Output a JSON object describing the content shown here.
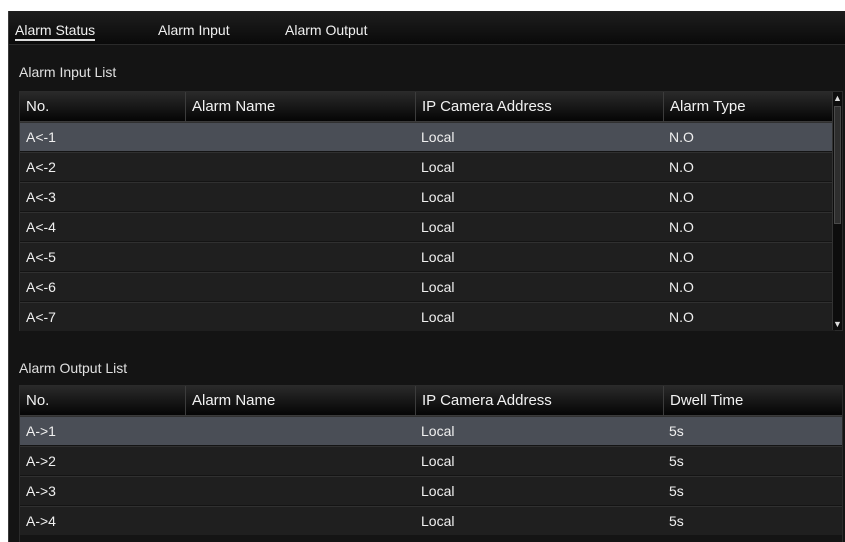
{
  "tabs": [
    {
      "label": "Alarm Status",
      "active": true
    },
    {
      "label": "Alarm Input",
      "active": false
    },
    {
      "label": "Alarm Output",
      "active": false
    }
  ],
  "input_list": {
    "title": "Alarm Input List",
    "columns": [
      "No.",
      "Alarm Name",
      "IP Camera Address",
      "Alarm Type"
    ],
    "rows": [
      {
        "no": "A<-1",
        "name": "",
        "ip": "Local",
        "type": "N.O"
      },
      {
        "no": "A<-2",
        "name": "",
        "ip": "Local",
        "type": "N.O"
      },
      {
        "no": "A<-3",
        "name": "",
        "ip": "Local",
        "type": "N.O"
      },
      {
        "no": "A<-4",
        "name": "",
        "ip": "Local",
        "type": "N.O"
      },
      {
        "no": "A<-5",
        "name": "",
        "ip": "Local",
        "type": "N.O"
      },
      {
        "no": "A<-6",
        "name": "",
        "ip": "Local",
        "type": "N.O"
      },
      {
        "no": "A<-7",
        "name": "",
        "ip": "Local",
        "type": "N.O"
      }
    ],
    "selected_row": 0
  },
  "output_list": {
    "title": "Alarm Output List",
    "columns": [
      "No.",
      "Alarm Name",
      "IP Camera Address",
      "Dwell Time"
    ],
    "rows": [
      {
        "no": "A->1",
        "name": "",
        "ip": "Local",
        "dwell": "5s"
      },
      {
        "no": "A->2",
        "name": "",
        "ip": "Local",
        "dwell": "5s"
      },
      {
        "no": "A->3",
        "name": "",
        "ip": "Local",
        "dwell": "5s"
      },
      {
        "no": "A->4",
        "name": "",
        "ip": "Local",
        "dwell": "5s"
      }
    ],
    "selected_row": 0
  },
  "colors": {
    "background": "#141414",
    "row": "#1f1f1f",
    "row_selected": "#4a4e56",
    "text": "#f0f0f0"
  }
}
